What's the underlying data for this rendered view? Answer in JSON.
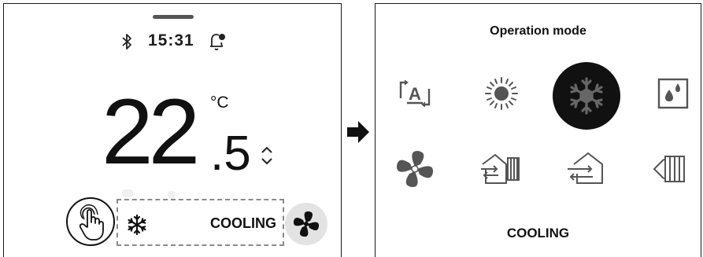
{
  "thermostat": {
    "time": "15:31",
    "temperature_int": "22",
    "temperature_dec": ".5",
    "unit": "°C",
    "mode_label": "COOLING",
    "icons": [
      "bluetooth-icon",
      "bell-icon",
      "up-down-arrows-icon",
      "hand-touch-icon",
      "snowflake-icon",
      "fan-icon"
    ]
  },
  "operation_dialog": {
    "title": "Operation mode",
    "modes": [
      {
        "id": "auto",
        "icon": "auto-mode-icon",
        "selected": false
      },
      {
        "id": "heat",
        "icon": "sun-icon",
        "selected": false
      },
      {
        "id": "cool",
        "icon": "snowflake-icon",
        "selected": true
      },
      {
        "id": "dry",
        "icon": "drops-icon",
        "selected": false
      },
      {
        "id": "fan",
        "icon": "fan-icon",
        "selected": false
      },
      {
        "id": "ventilation",
        "icon": "ventilation-icon",
        "selected": false
      },
      {
        "id": "heat-recovery",
        "icon": "house-arrows-icon",
        "selected": false
      },
      {
        "id": "bypass",
        "icon": "bypass-icon",
        "selected": false
      }
    ],
    "current_mode_label": "COOLING"
  },
  "colors": {
    "selected_bg": "#111111",
    "fan_button_bg": "#e3e3e3",
    "dashed_border": "#8a8a8a",
    "icon_gray": "#555555"
  }
}
